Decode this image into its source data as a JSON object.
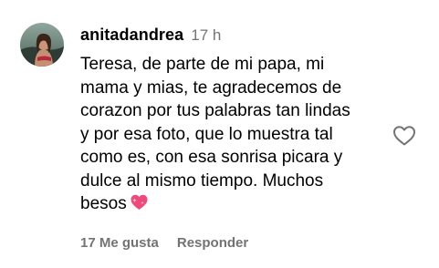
{
  "comment": {
    "username": "anitadandrea",
    "timestamp": "17 h",
    "text_lines": [
      "Teresa, de parte de mi papa, mi",
      "mama y mias, te agradecemos de",
      "corazon por tus palabras tan lindas",
      "y por esa foto, que lo muestra tal",
      "como es, con esa sonrisa picara y",
      "dulce al mismo tiempo. Muchos",
      "besos"
    ],
    "emoji": "heart-with-sparkles-emoji",
    "likes_label": "17 Me gusta",
    "reply_label": "Responder"
  },
  "colors": {
    "text": "#000000",
    "secondary": "#737373",
    "heart_emoji": "#f0487a"
  },
  "icons": {
    "like": "heart-outline-icon"
  }
}
